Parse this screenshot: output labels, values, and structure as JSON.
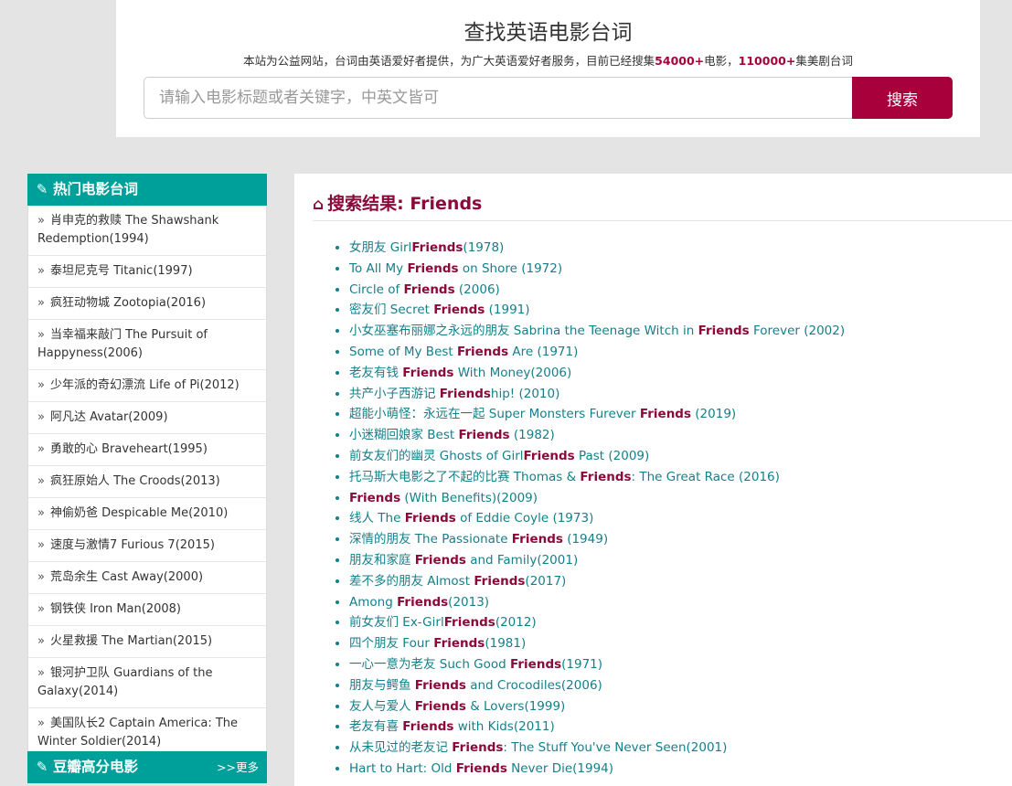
{
  "header": {
    "title": "查找英语电影台词",
    "desc_prefix": "本站为公益网站，台词由英语爱好者提供，为广大英语爱好者服务，目前已经搜集",
    "movie_count": "54000+",
    "desc_middle": "电影，",
    "episode_count": "110000+",
    "desc_suffix": "集美剧台词",
    "search_placeholder": "请输入电影标题或者关键字，中英文皆可",
    "search_button": "搜索"
  },
  "sidebar": {
    "hot_title": "热门电影台词",
    "hot_items": [
      "肖申克的救赎 The Shawshank Redemption(1994)",
      "泰坦尼克号 Titanic(1997)",
      "疯狂动物城 Zootopia(2016)",
      "当幸福来敲门 The Pursuit of Happyness(2006)",
      "少年派的奇幻漂流 Life of Pi(2012)",
      "阿凡达 Avatar(2009)",
      "勇敢的心 Braveheart(1995)",
      "疯狂原始人 The Croods(2013)",
      "神偷奶爸 Despicable Me(2010)",
      "速度与激情7 Furious 7(2015)",
      "荒岛余生 Cast Away(2000)",
      "钢铁侠 Iron Man(2008)",
      "火星救援 The Martian(2015)",
      "银河护卫队 Guardians of the Galaxy(2014)",
      "美国队长2 Captain America: The Winter Soldier(2014)"
    ],
    "douban_title": "豆瓣高分电影",
    "more_label": ">>更多"
  },
  "main": {
    "result_title": "搜索结果: Friends",
    "keyword": "Friends",
    "results": [
      [
        "女朋友 Girl",
        "Friends",
        "(1978)"
      ],
      [
        "To All My ",
        "Friends",
        " on Shore (1972)"
      ],
      [
        "Circle of ",
        "Friends",
        " (2006)"
      ],
      [
        "密友们 Secret ",
        "Friends",
        " (1991)"
      ],
      [
        "小女巫塞布丽娜之永远的朋友 Sabrina the Teenage Witch in ",
        "Friends",
        " Forever (2002)"
      ],
      [
        "Some of My Best ",
        "Friends",
        " Are (1971)"
      ],
      [
        "老友有钱 ",
        "Friends",
        " With Money(2006)"
      ],
      [
        "共产小子西游记 ",
        "Friends",
        "hip! (2010)"
      ],
      [
        "超能小萌怪：永远在一起 Super Monsters Furever ",
        "Friends",
        " (2019)"
      ],
      [
        "小迷糊回娘家 Best ",
        "Friends",
        " (1982)"
      ],
      [
        "前女友们的幽灵 Ghosts of Girl",
        "Friends",
        " Past (2009)"
      ],
      [
        "托马斯大电影之了不起的比赛 Thomas & ",
        "Friends",
        ": The Great Race (2016)"
      ],
      [
        "",
        "Friends",
        " (With Benefits)(2009)"
      ],
      [
        "线人 The ",
        "Friends",
        " of Eddie Coyle (1973)"
      ],
      [
        "深情的朋友 The Passionate ",
        "Friends",
        " (1949)"
      ],
      [
        "朋友和家庭 ",
        "Friends",
        " and Family(2001)"
      ],
      [
        "差不多的朋友 Almost ",
        "Friends",
        "(2017)"
      ],
      [
        "Among ",
        "Friends",
        "(2013)"
      ],
      [
        "前女友们 Ex-Girl",
        "Friends",
        "(2012)"
      ],
      [
        "四个朋友 Four ",
        "Friends",
        "(1981)"
      ],
      [
        "一心一意为老友 Such Good ",
        "Friends",
        "(1971)"
      ],
      [
        "朋友与鳄鱼 ",
        "Friends",
        " and Crocodiles(2006)"
      ],
      [
        "友人与爱人 ",
        "Friends",
        " & Lovers(1999)"
      ],
      [
        "老友有喜 ",
        "Friends",
        " with Kids(2011)"
      ],
      [
        "从未见过的老友记 ",
        "Friends",
        ": The Stuff You've Never Seen(2001)"
      ],
      [
        "Hart to Hart: Old ",
        "Friends",
        " Never Die(1994)"
      ]
    ]
  }
}
